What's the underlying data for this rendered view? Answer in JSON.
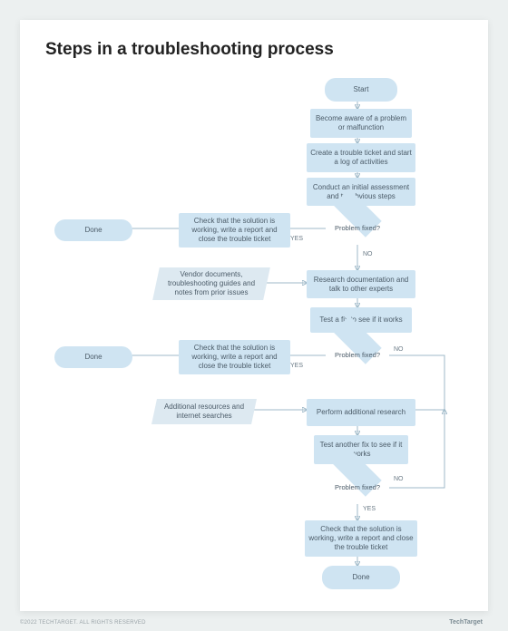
{
  "title": "Steps in a troubleshooting process",
  "terminals": {
    "start": "Start",
    "done1": "Done",
    "done2": "Done",
    "done3": "Done"
  },
  "process": {
    "become_aware": "Become aware of a problem or malfunction",
    "create_ticket": "Create a trouble ticket and start a log of activities",
    "initial_assessment": "Conduct an initial assessment and try obvious steps",
    "check_solution_1": "Check that the solution is working, write a report and close the trouble ticket",
    "research_docs": "Research documentation and talk to other experts",
    "test_fix_1": "Test a fix to see if it works",
    "check_solution_2": "Check that the solution is working, write a report and close the trouble ticket",
    "additional_research": "Perform additional research",
    "test_fix_2": "Test another fix to see if it works",
    "check_solution_3": "Check that the solution is working, write a report and close the trouble ticket"
  },
  "inputs": {
    "vendor_docs": "Vendor documents, troubleshooting guides and notes from prior issues",
    "additional_resources": "Additional resources and internet searches"
  },
  "decisions": {
    "fixed_1": "Problem fixed?",
    "fixed_2": "Problem fixed?",
    "fixed_3": "Problem fixed?"
  },
  "branch_labels": {
    "yes": "YES",
    "no": "NO"
  },
  "footer": {
    "copyright": "©2022 TECHTARGET. ALL RIGHTS RESERVED",
    "brand": "TechTarget"
  }
}
